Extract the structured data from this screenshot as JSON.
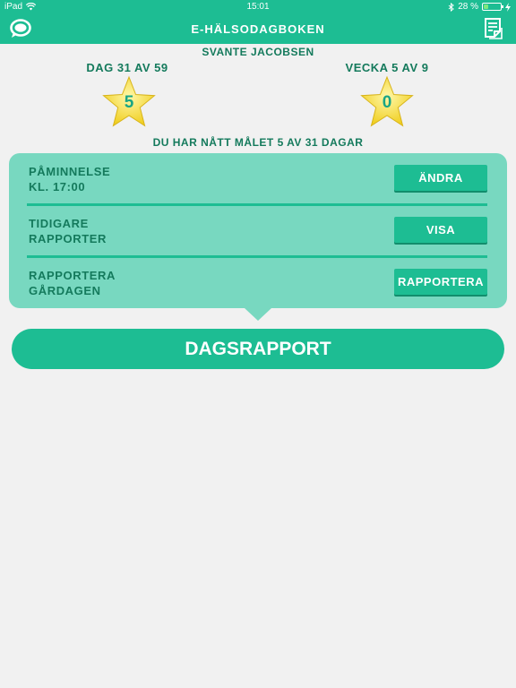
{
  "status": {
    "device": "iPad",
    "time": "15:01",
    "battery": "28 %",
    "battery_level": 0.28,
    "icons": [
      "wifi-icon",
      "bluetooth-icon",
      "battery-icon",
      "charging-icon"
    ]
  },
  "navbar": {
    "title": "E-HÄLSODAGBOKEN",
    "left_icon": "chat-bubble-icon",
    "right_icon": "notes-icon"
  },
  "user": {
    "name": "SVANTE JACOBSEN"
  },
  "stats": {
    "day_label": "DAG 31 AV 59",
    "day_stars": "5",
    "week_label": "VECKA 5 AV 9",
    "week_stars": "0"
  },
  "goal_text": "DU HAR NÅTT MÅLET 5 AV 31 DAGAR",
  "panel": {
    "rows": [
      {
        "label_line1": "PÅMINNELSE",
        "label_line2": "KL. 17:00",
        "button": "ÄNDRA"
      },
      {
        "label_line1": "TIDIGARE",
        "label_line2": "RAPPORTER",
        "button": "VISA"
      },
      {
        "label_line1": "RAPPORTERA",
        "label_line2": "GÅRDAGEN",
        "button": "RAPPORTERA"
      }
    ]
  },
  "main_button": "DAGSRAPPORT",
  "colors": {
    "accent": "#1dbd93",
    "panel": "#78d8c0",
    "text_dark": "#147a5c",
    "star": "#f5dc3c",
    "background": "#f1f1f1"
  }
}
